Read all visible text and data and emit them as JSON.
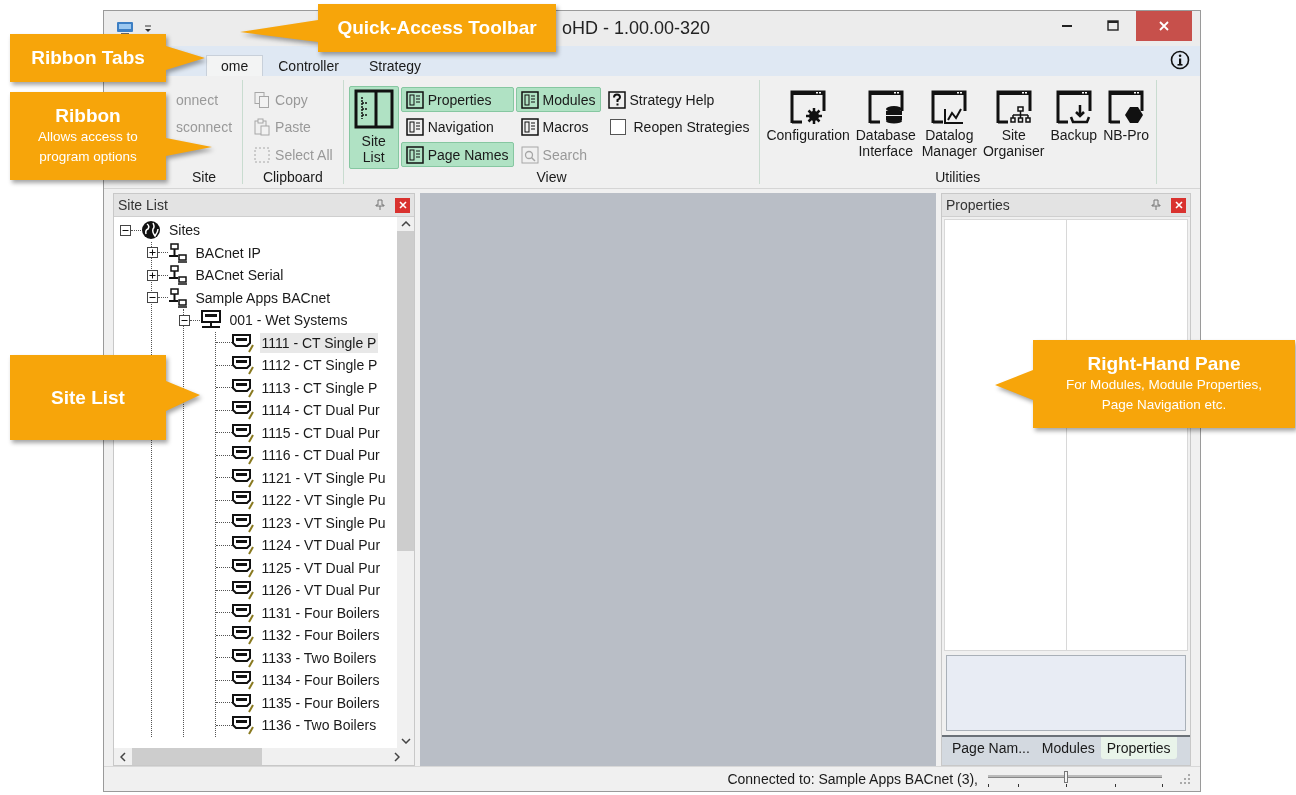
{
  "window": {
    "title": "oHD - 1.00.00-320"
  },
  "tabs": [
    {
      "label": "ome",
      "selected": true
    },
    {
      "label": "Controller",
      "selected": false
    },
    {
      "label": "Strategy",
      "selected": false
    }
  ],
  "ribbon": {
    "groups": [
      {
        "label": "Site",
        "items": [
          {
            "kind": "small",
            "label": "onnect",
            "disabled": true
          },
          {
            "kind": "small",
            "label": "sconnect",
            "disabled": true
          }
        ]
      },
      {
        "label": "Clipboard",
        "items": [
          {
            "kind": "small",
            "label": "Copy",
            "disabled": true
          },
          {
            "kind": "small",
            "label": "Paste",
            "disabled": true
          },
          {
            "kind": "small",
            "label": "Select All",
            "disabled": true
          }
        ]
      },
      {
        "label": "View",
        "items": [
          {
            "kind": "large",
            "label": "Site\nList",
            "selected": true,
            "disabled": false
          },
          {
            "kind": "small",
            "label": "Properties",
            "selected": true,
            "disabled": false
          },
          {
            "kind": "small",
            "label": "Navigation",
            "selected": false,
            "disabled": false
          },
          {
            "kind": "small",
            "label": "Page Names",
            "selected": true,
            "disabled": false
          },
          {
            "kind": "small",
            "label": "Modules",
            "selected": true,
            "disabled": false
          },
          {
            "kind": "small",
            "label": "Macros",
            "selected": false,
            "disabled": false
          },
          {
            "kind": "small",
            "label": "Search",
            "selected": false,
            "disabled": true
          },
          {
            "kind": "small",
            "label": "Strategy Help",
            "selected": false,
            "disabled": false
          },
          {
            "kind": "checkbox",
            "label": "Reopen Strategies",
            "checked": false,
            "disabled": false
          }
        ]
      },
      {
        "label": "Utilities",
        "items": [
          {
            "kind": "large",
            "label": "Configuration"
          },
          {
            "kind": "large",
            "label": "Database\nInterface"
          },
          {
            "kind": "large",
            "label": "Datalog\nManager"
          },
          {
            "kind": "large",
            "label": "Site\nOrganiser"
          },
          {
            "kind": "large",
            "label": "Backup"
          },
          {
            "kind": "large",
            "label": "NB-Pro"
          }
        ]
      }
    ]
  },
  "site_list": {
    "title": "Site List",
    "tree": [
      {
        "kind": "root",
        "label": "Sites",
        "expanded": true,
        "selected": false,
        "children": [
          {
            "kind": "network",
            "label": "BACnet IP",
            "expanded": false,
            "selected": false
          },
          {
            "kind": "network",
            "label": "BACnet Serial",
            "expanded": false,
            "selected": false
          },
          {
            "kind": "network",
            "label": "Sample Apps BACnet",
            "expanded": true,
            "selected": false,
            "children": [
              {
                "kind": "device",
                "label": "001 - Wet Systems",
                "expanded": true,
                "selected": false,
                "children": [
                  {
                    "kind": "controller",
                    "label": "1111 - CT Single P",
                    "selected": true
                  },
                  {
                    "kind": "controller",
                    "label": "1112 - CT Single P",
                    "selected": false
                  },
                  {
                    "kind": "controller",
                    "label": "1113 - CT Single P",
                    "selected": false
                  },
                  {
                    "kind": "controller",
                    "label": "1114 - CT Dual Pur",
                    "selected": false
                  },
                  {
                    "kind": "controller",
                    "label": "1115 - CT Dual Pur",
                    "selected": false
                  },
                  {
                    "kind": "controller",
                    "label": "1116 - CT Dual Pur",
                    "selected": false
                  },
                  {
                    "kind": "controller",
                    "label": "1121 - VT Single Pu",
                    "selected": false
                  },
                  {
                    "kind": "controller",
                    "label": "1122 - VT Single Pu",
                    "selected": false
                  },
                  {
                    "kind": "controller",
                    "label": "1123 - VT Single Pu",
                    "selected": false
                  },
                  {
                    "kind": "controller",
                    "label": "1124 - VT Dual Pur",
                    "selected": false
                  },
                  {
                    "kind": "controller",
                    "label": "1125 - VT Dual Pur",
                    "selected": false
                  },
                  {
                    "kind": "controller",
                    "label": "1126 - VT Dual Pur",
                    "selected": false
                  },
                  {
                    "kind": "controller",
                    "label": "1131 - Four Boilers",
                    "selected": false
                  },
                  {
                    "kind": "controller",
                    "label": "1132 - Four Boilers",
                    "selected": false
                  },
                  {
                    "kind": "controller",
                    "label": "1133 - Two Boilers",
                    "selected": false
                  },
                  {
                    "kind": "controller",
                    "label": "1134 - Four Boilers",
                    "selected": false
                  },
                  {
                    "kind": "controller",
                    "label": "1135 - Four Boilers",
                    "selected": false
                  },
                  {
                    "kind": "controller",
                    "label": "1136 - Two Boilers",
                    "selected": false
                  }
                ]
              }
            ]
          }
        ]
      }
    ]
  },
  "properties_pane": {
    "title": "Properties",
    "tabs": [
      {
        "label": "Page Nam...",
        "selected": false
      },
      {
        "label": "Modules",
        "selected": false
      },
      {
        "label": "Properties",
        "selected": true
      }
    ]
  },
  "status_bar": {
    "text": "Connected to: Sample Apps BACnet (3),",
    "zoom": {
      "level": 0.45
    }
  },
  "callouts": [
    {
      "title": "Quick-Access Toolbar"
    },
    {
      "title": "Ribbon Tabs"
    },
    {
      "title": "Ribbon",
      "text": "Allows access to program options"
    },
    {
      "title": "Site List"
    },
    {
      "title": "Right-Hand Pane",
      "text": "For Modules, Module Properties, Page Navigation etc."
    }
  ]
}
